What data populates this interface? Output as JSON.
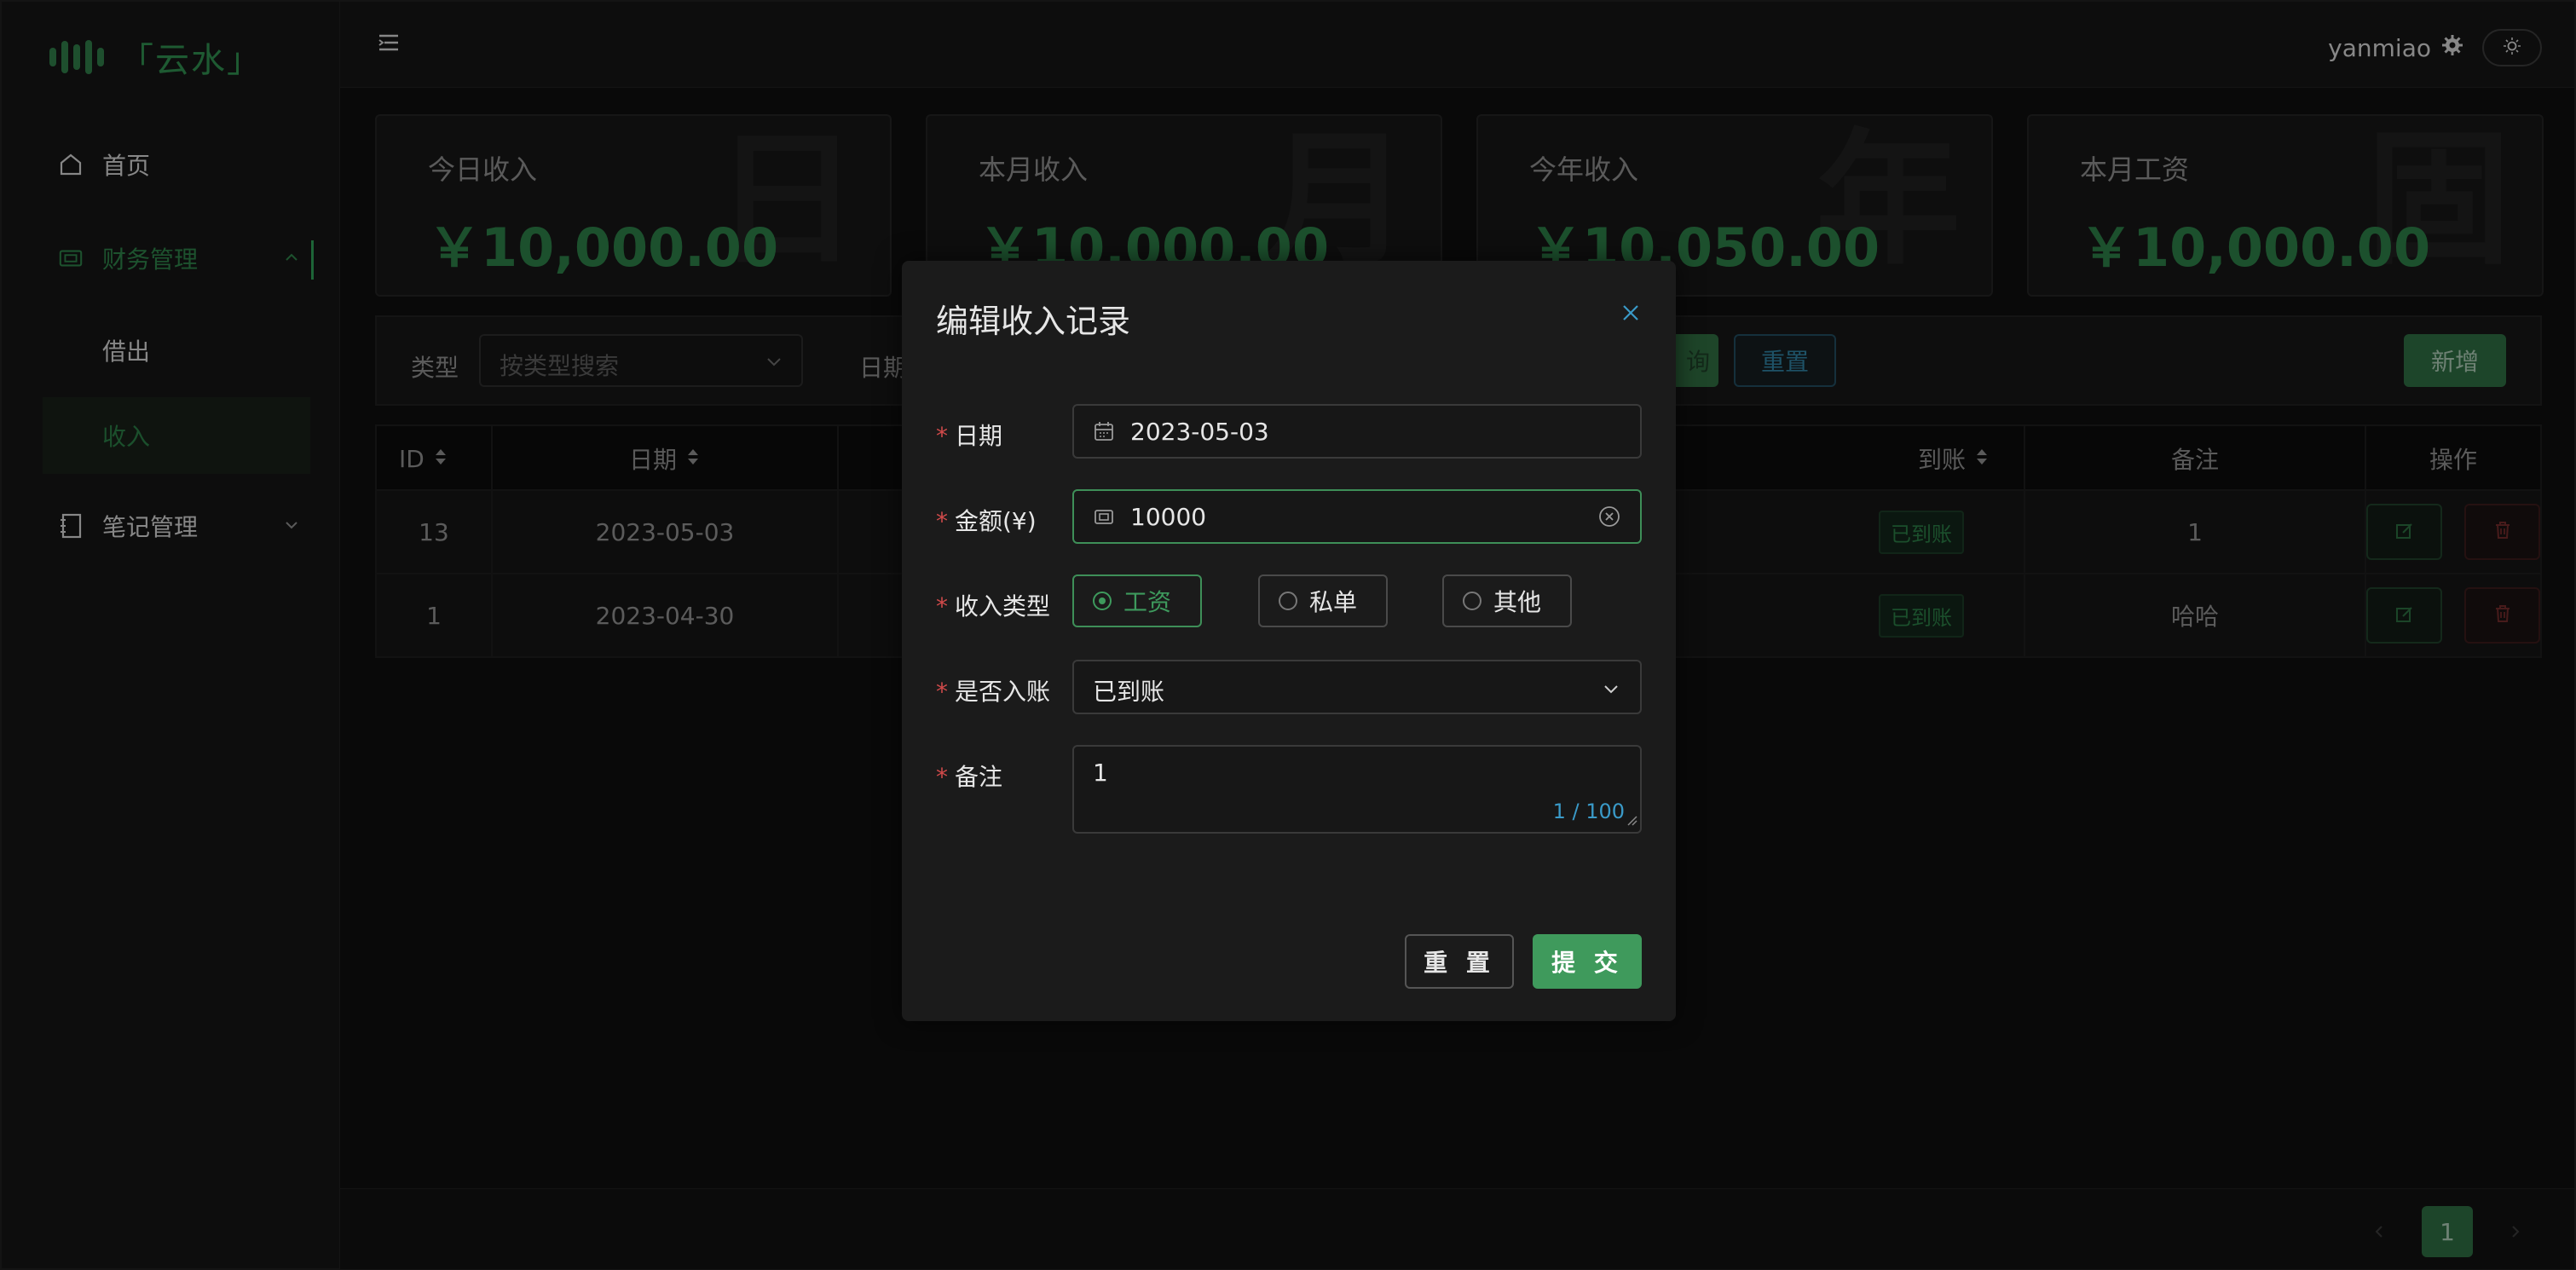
{
  "app": {
    "logo_text": "「云水」"
  },
  "sidebar": {
    "items": [
      {
        "label": "首页"
      },
      {
        "label": "财务管理",
        "children": [
          {
            "label": "借出"
          },
          {
            "label": "收入"
          }
        ]
      },
      {
        "label": "笔记管理"
      }
    ]
  },
  "topbar": {
    "username": "yanmiao"
  },
  "stats": [
    {
      "label": "今日收入",
      "value": "￥10,000.00",
      "bg": "日"
    },
    {
      "label": "本月收入",
      "value": "￥10,000.00",
      "bg": "月"
    },
    {
      "label": "今年收入",
      "value": "￥10,050.00",
      "bg": "年"
    },
    {
      "label": "本月工资",
      "value": "￥10,000.00",
      "bg": "固"
    }
  ],
  "filter": {
    "type_label": "类型",
    "type_placeholder": "按类型搜索",
    "date_label": "日期",
    "search_label": "询",
    "reset_label": "重置",
    "add_label": "新增"
  },
  "table": {
    "columns": [
      "ID",
      "日期",
      "到账",
      "备注",
      "操作"
    ],
    "rows": [
      {
        "id": "13",
        "date": "2023-05-03",
        "status": "已到账",
        "remark": "1"
      },
      {
        "id": "1",
        "date": "2023-04-30",
        "status": "已到账",
        "remark": "哈哈"
      }
    ]
  },
  "pagination": {
    "current": "1"
  },
  "modal": {
    "title": "编辑收入记录",
    "fields": {
      "date": {
        "label": "日期",
        "value": "2023-05-03"
      },
      "amount": {
        "label": "金额(¥)",
        "value": "10000"
      },
      "type": {
        "label": "收入类型",
        "options": [
          "工资",
          "私单",
          "其他"
        ],
        "selected": "工资"
      },
      "booked": {
        "label": "是否入账",
        "value": "已到账"
      },
      "remark": {
        "label": "备注",
        "value": "1",
        "counter": "1 / 100"
      }
    },
    "reset_label": "重 置",
    "submit_label": "提 交"
  },
  "colors": {
    "accent": "#3f9a5c",
    "danger": "#d04a4a",
    "info": "#2f7e9e"
  }
}
